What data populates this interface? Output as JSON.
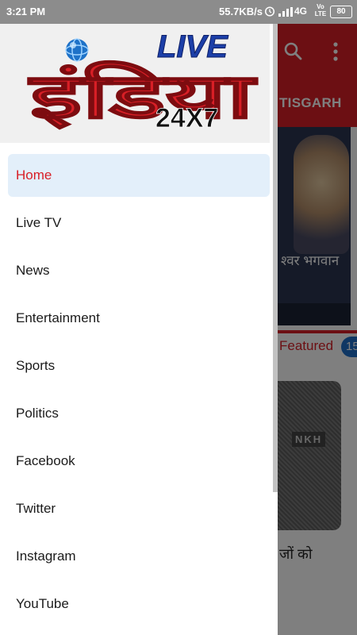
{
  "status_bar": {
    "time": "3:21 PM",
    "network_speed": "55.7KB/s",
    "network_type": "4G",
    "volte_label": "Vo LTE",
    "battery_level": "80"
  },
  "logo": {
    "live_text": "LIVE",
    "hindi_text": "इंडिया",
    "suffix_text": "24X7"
  },
  "menu": {
    "items": [
      {
        "label": "Home",
        "active": true
      },
      {
        "label": "Live TV"
      },
      {
        "label": "News"
      },
      {
        "label": "Entertainment"
      },
      {
        "label": "Sports"
      },
      {
        "label": "Politics"
      },
      {
        "label": "Facebook"
      },
      {
        "label": "Twitter"
      },
      {
        "label": "Instagram"
      },
      {
        "label": "YouTube"
      }
    ]
  },
  "background_app": {
    "tab_label": "TISGARH",
    "hero_caption": "श्वर भगवान",
    "featured_label": "Featured",
    "featured_badge": "15",
    "card_image_text": "NKH",
    "card_caption": "जों को"
  },
  "colors": {
    "brand_red": "#d81f26",
    "active_bg": "#e3effa",
    "logo_blue": "#1c3fa8"
  }
}
